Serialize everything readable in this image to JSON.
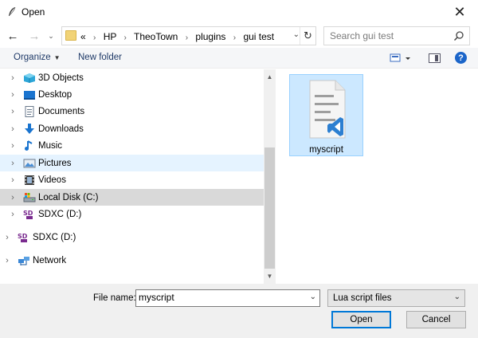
{
  "window": {
    "title": "Open",
    "close_glyph": "✕"
  },
  "nav": {
    "back_glyph": "←",
    "forward_glyph": "→",
    "history_glyph": "⌄"
  },
  "address": {
    "prefix": "«",
    "crumbs": [
      "HP",
      "TheoTown",
      "plugins",
      "gui test"
    ],
    "dropdown_glyph": "⌄",
    "refresh_glyph": "↻"
  },
  "search": {
    "placeholder": "Search gui test"
  },
  "toolbar": {
    "organize_label": "Organize",
    "new_folder_label": "New folder",
    "help_glyph": "?"
  },
  "tree": [
    {
      "label": "3D Objects",
      "icon": "3d-objects-icon",
      "state": "normal"
    },
    {
      "label": "Desktop",
      "icon": "desktop-icon",
      "state": "normal"
    },
    {
      "label": "Documents",
      "icon": "documents-icon",
      "state": "normal"
    },
    {
      "label": "Downloads",
      "icon": "downloads-icon",
      "state": "normal"
    },
    {
      "label": "Music",
      "icon": "music-icon",
      "state": "normal"
    },
    {
      "label": "Pictures",
      "icon": "pictures-icon",
      "state": "hover"
    },
    {
      "label": "Videos",
      "icon": "videos-icon",
      "state": "normal"
    },
    {
      "label": "Local Disk (C:)",
      "icon": "local-disk-icon",
      "state": "selected"
    },
    {
      "label": "SDXC (D:)",
      "icon": "sdxc-icon",
      "state": "normal"
    },
    {
      "label": "SDXC (D:)",
      "icon": "sdxc-icon",
      "state": "normal"
    },
    {
      "label": "Network",
      "icon": "network-icon",
      "state": "normal"
    }
  ],
  "files": [
    {
      "name": "myscript",
      "icon": "lua-script-file-icon",
      "selected": true
    }
  ],
  "bottom": {
    "file_name_label": "File name:",
    "file_name_value": "myscript",
    "filter_value": "Lua script files",
    "open_label": "Open",
    "cancel_label": "Cancel"
  },
  "colors": {
    "hover": "#e5f3ff",
    "selected_tree": "#d9d9d9",
    "selected_file": "#cce8ff",
    "accent": "#0078d7"
  }
}
